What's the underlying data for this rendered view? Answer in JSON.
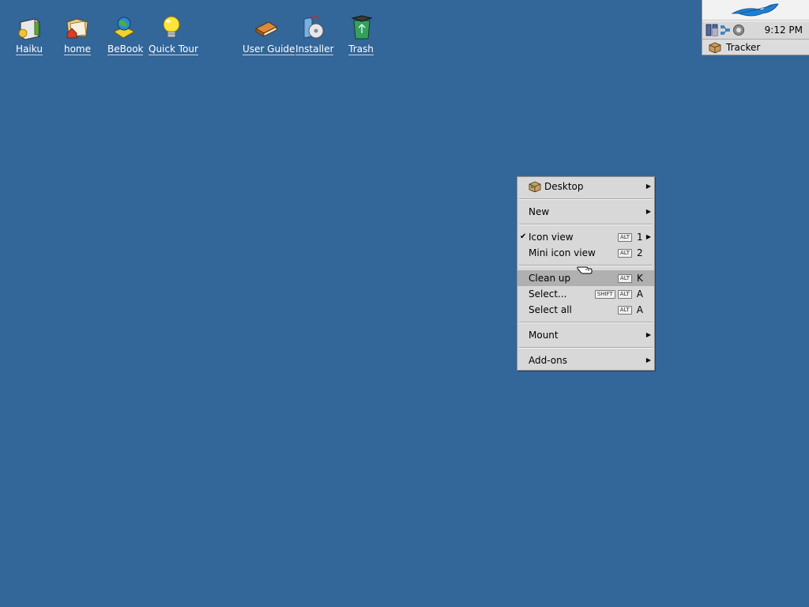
{
  "desktop": {
    "background": "#336699",
    "icons": [
      {
        "label": "Haiku",
        "icon": "haiku-volume-icon"
      },
      {
        "label": "home",
        "icon": "home-folder-icon"
      },
      {
        "label": "BeBook",
        "icon": "bebook-icon"
      },
      {
        "label": "Quick Tour",
        "icon": "lightbulb-icon"
      },
      {
        "label": "User Guide",
        "icon": "user-guide-book-icon"
      },
      {
        "label": "Installer",
        "icon": "installer-icon"
      },
      {
        "label": "Trash",
        "icon": "trash-icon"
      }
    ]
  },
  "deskbar": {
    "clock": "9:12 PM",
    "tracker_label": "Tracker"
  },
  "context_menu": {
    "header": "Desktop",
    "new": "New",
    "icon_view": {
      "label": "Icon view",
      "mod": "ALT",
      "key": "1",
      "checked": true
    },
    "mini_icon_view": {
      "label": "Mini icon view",
      "mod": "ALT",
      "key": "2"
    },
    "clean_up": {
      "label": "Clean up",
      "mod": "ALT",
      "key": "K"
    },
    "select": {
      "label": "Select...",
      "mod1": "SHIFT",
      "mod2": "ALT",
      "key": "A"
    },
    "select_all": {
      "label": "Select all",
      "mod": "ALT",
      "key": "A"
    },
    "mount": "Mount",
    "addons": "Add-ons"
  }
}
